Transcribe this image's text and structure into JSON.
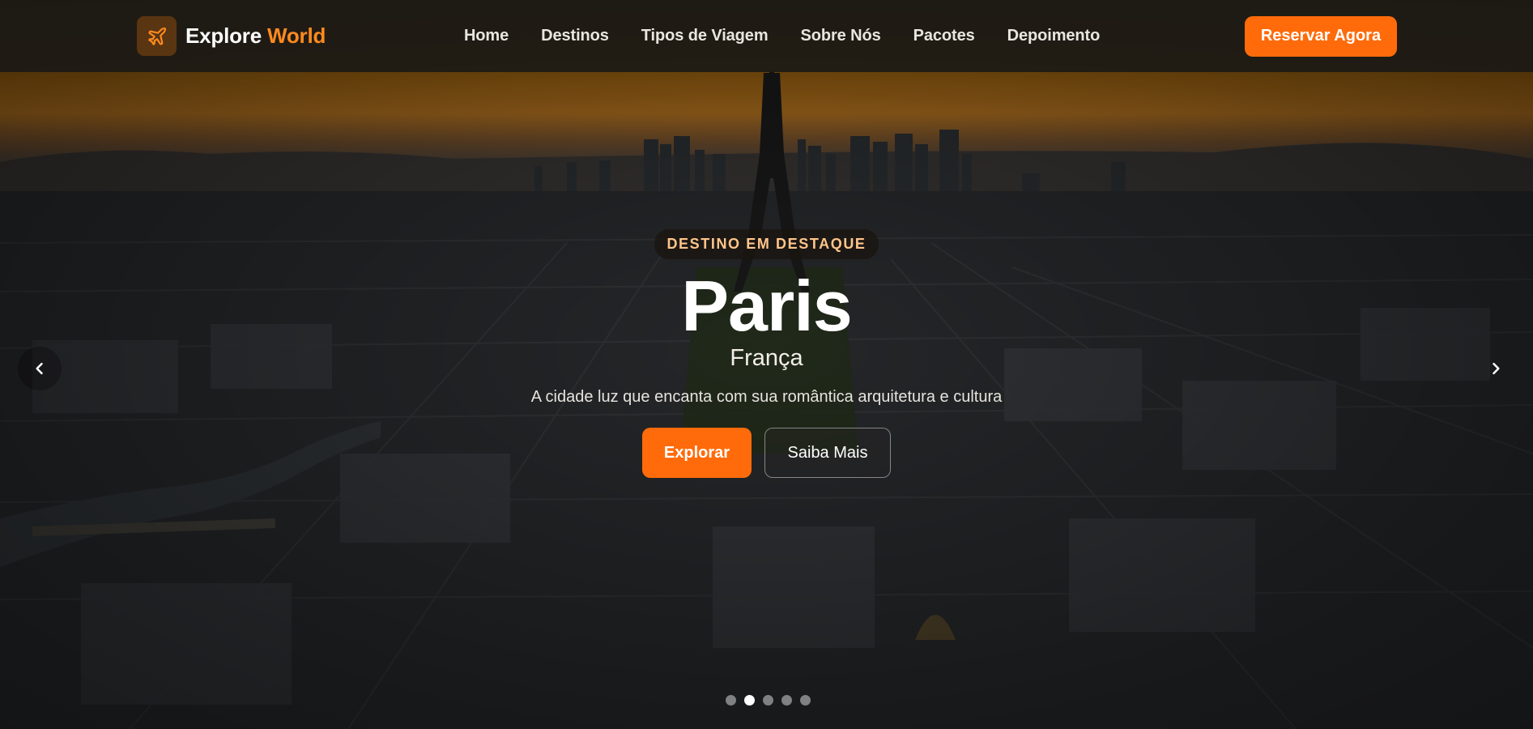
{
  "brand": {
    "name_primary": "Explore",
    "name_accent": "World",
    "icon": "airplane-icon",
    "accent_color": "#ff8a1e"
  },
  "nav": {
    "links": [
      {
        "label": "Home"
      },
      {
        "label": "Destinos"
      },
      {
        "label": "Tipos de Viagem"
      },
      {
        "label": "Sobre Nós"
      },
      {
        "label": "Pacotes"
      },
      {
        "label": "Depoimento"
      }
    ],
    "cta_label": "Reservar Agora"
  },
  "hero": {
    "badge": "DESTINO EM DESTAQUE",
    "title": "Paris",
    "country": "França",
    "tagline": "A cidade luz que encanta com sua romântica arquitetura e cultura",
    "primary_button": "Explorar",
    "secondary_button": "Saiba Mais",
    "slides_total": 5,
    "active_slide": 2
  },
  "colors": {
    "primary": "#ff6b0a",
    "badge_text": "#ffc58a",
    "navbar_bg": "#1c1a16"
  },
  "icons": {
    "prev": "chevron-left-icon",
    "next": "chevron-right-icon"
  }
}
